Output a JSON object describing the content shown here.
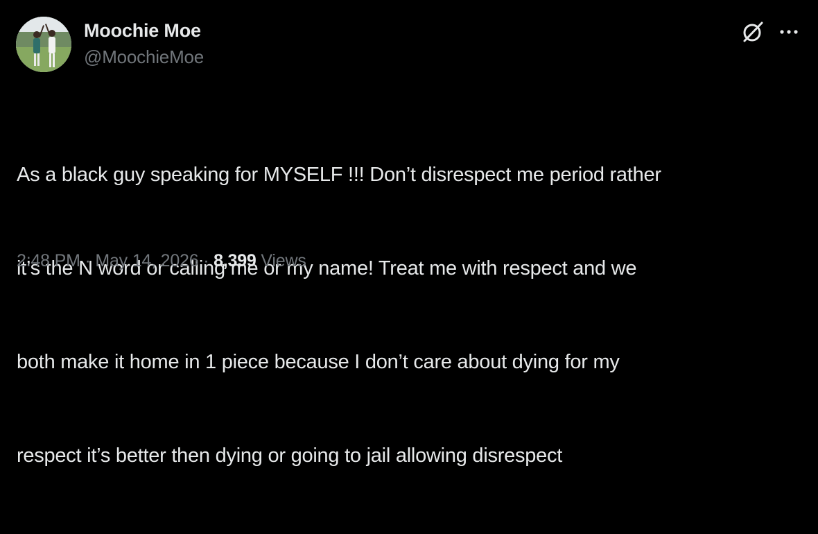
{
  "tweet": {
    "author": {
      "display_name": "Moochie Moe",
      "handle": "@MoochieMoe",
      "avatar_icon": "profile-photo"
    },
    "actions": {
      "grok_icon": "grok-icon",
      "more_icon": "more-options-icon"
    },
    "text_lines": [
      "As a black guy speaking for MYSELF !!! Don’t disrespect me period rather",
      "it’s the N word or calling me or my name! Treat me with respect and we",
      "both make it home in 1 piece because I don’t care about dying for my",
      "respect it’s better then dying or going to jail allowing disrespect"
    ],
    "meta": {
      "time": "2:48 PM",
      "separator": "·",
      "date": "May 14, 2026",
      "views_count": "8,399",
      "views_label": "Views"
    }
  },
  "colors": {
    "background": "#000000",
    "primary_text": "#e7e9ea",
    "secondary_text": "#71767b"
  }
}
